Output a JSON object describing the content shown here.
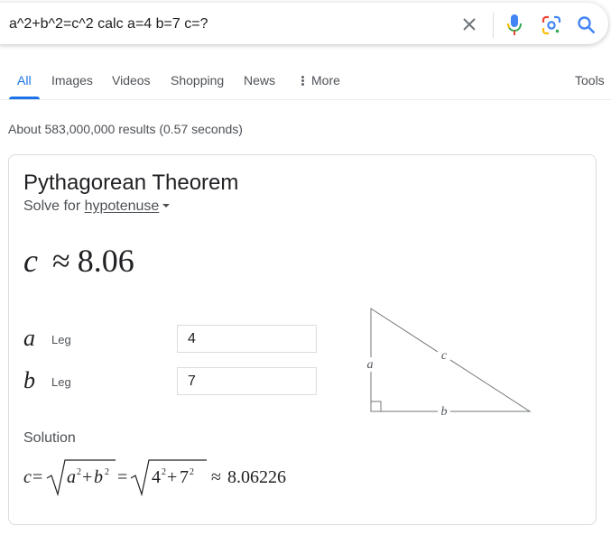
{
  "search": {
    "query": "a^2+b^2=c^2 calc a=4 b=7 c=?"
  },
  "tabs": [
    {
      "label": "All"
    },
    {
      "label": "Images"
    },
    {
      "label": "Videos"
    },
    {
      "label": "Shopping"
    },
    {
      "label": "News"
    },
    {
      "label": "More"
    },
    {
      "label": "Tools"
    }
  ],
  "stats": "About 583,000,000 results (0.57 seconds)",
  "calculator": {
    "title": "Pythagorean Theorem",
    "solve_prefix": "Solve for",
    "solve_target": "hypotenuse",
    "result_var": "c",
    "result_approx": "≈",
    "result_value": "8.06",
    "legs": [
      {
        "var": "a",
        "label": "Leg",
        "value": "4"
      },
      {
        "var": "b",
        "label": "Leg",
        "value": "7"
      }
    ],
    "diagram_labels": {
      "a": "a",
      "b": "b",
      "c": "c"
    },
    "solution_label": "Solution",
    "solution_result": "8.06226"
  },
  "colors": {
    "accent": "#1a73e8",
    "mic_blue": "#4285f4",
    "mic_red": "#ea4335"
  }
}
